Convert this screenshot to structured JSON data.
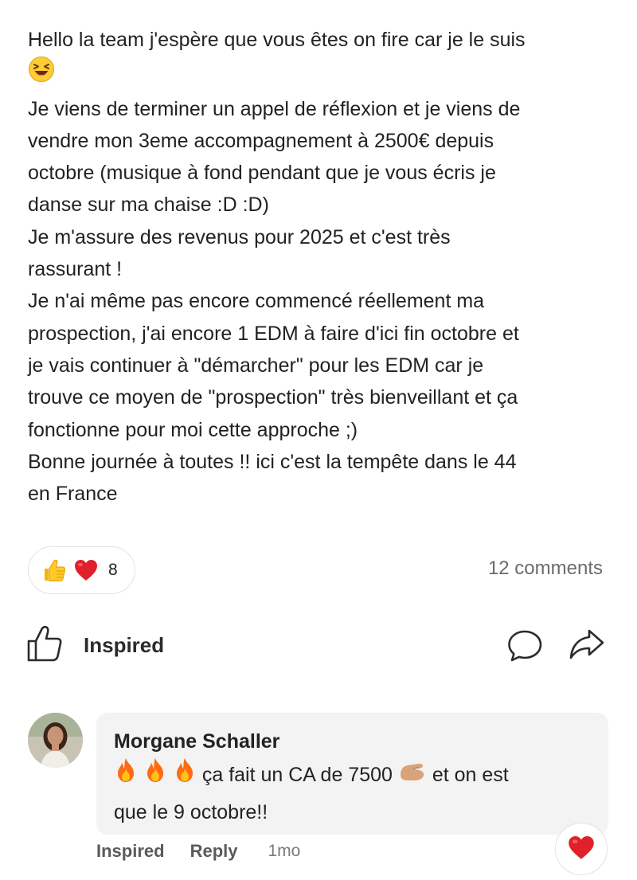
{
  "post": {
    "lines": [
      "Hello la team j'espère que vous êtes on fire car je le suis",
      "Je viens de terminer un appel de réflexion et je viens de",
      "vendre mon 3eme accompagnement à 2500€ depuis",
      "octobre (musique à fond pendant que je vous écris je",
      "danse sur ma chaise :D :D)",
      "Je m'assure des revenus pour 2025 et c'est très",
      "rassurant !",
      "Je n'ai même pas encore commencé réellement ma",
      "prospection, j'ai encore 1 EDM à faire d'ici fin octobre et",
      "je vais continuer à \"démarcher\" pour les EDM car je",
      "trouve ce moyen de \"prospection\" très bienveillant et ça",
      "fonctionne pour moi cette approche ;)",
      "Bonne journée à toutes !! ici c'est la tempête dans le 44",
      "en France"
    ],
    "emoji_after_line_1": "laughing-emoji"
  },
  "reactions": {
    "icons": [
      "thumbs-up-emoji",
      "red-heart-emoji"
    ],
    "count": "8"
  },
  "comments_count_label": "12 comments",
  "actions": {
    "like_label": "Inspired",
    "comment_icon": "comment-icon",
    "share_icon": "share-icon"
  },
  "comment": {
    "author": "Morgane Schaller",
    "text_part1": "ça fait un CA de 7500",
    "text_part2": "et on est",
    "text_line2": "que le 9 octobre!!",
    "emojis_before": [
      "fire-emoji",
      "fire-emoji",
      "fire-emoji"
    ],
    "emoji_mid": "pinching-hand-emoji",
    "meta": {
      "like_label": "Inspired",
      "reply_label": "Reply",
      "time": "1mo"
    },
    "reaction": "red-heart-emoji"
  },
  "colors": {
    "text": "#222222",
    "muted": "#6b6b6b",
    "bubble": "#f3f3f3",
    "heart": "#e0202a",
    "fire": "#ff6a13"
  }
}
